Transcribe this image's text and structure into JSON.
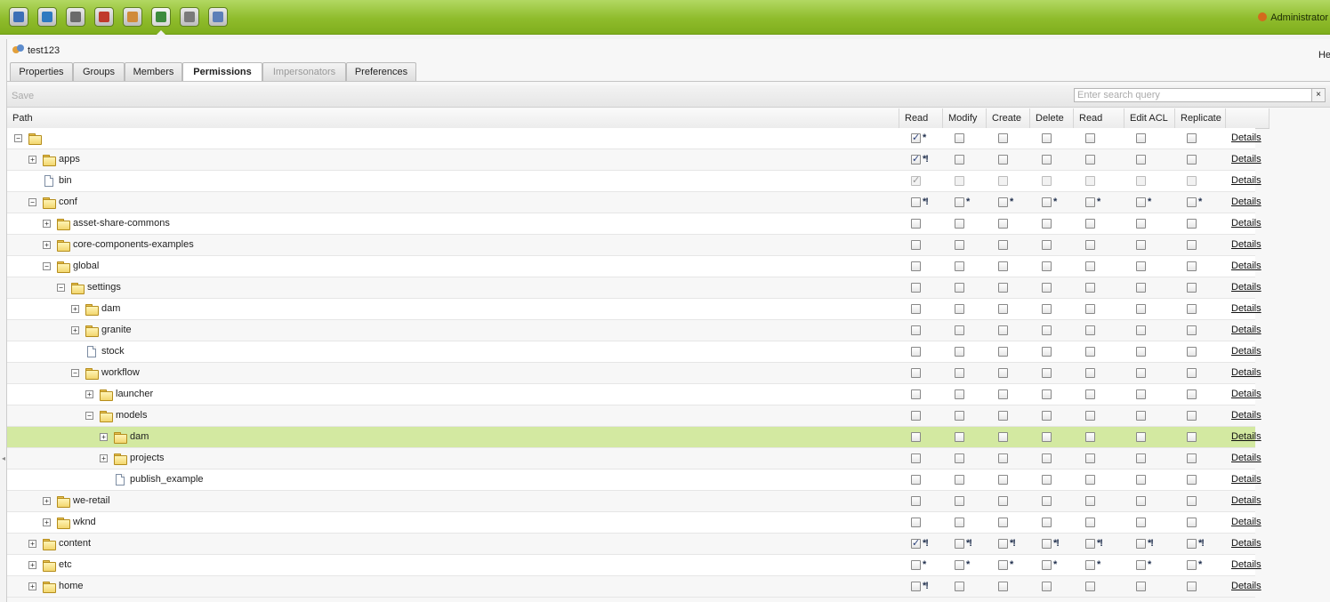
{
  "toolbar_icons": [
    {
      "name": "network-icon",
      "color": "#3d6fb6"
    },
    {
      "name": "globe-icon",
      "color": "#2f7ac0"
    },
    {
      "name": "binoculars-icon",
      "color": "#6a6a6a"
    },
    {
      "name": "megaphone-icon",
      "color": "#c0392b"
    },
    {
      "name": "envelope-icon",
      "color": "#d08b3a"
    },
    {
      "name": "users-icon",
      "color": "#3d8b3d"
    },
    {
      "name": "gear-icon",
      "color": "#7a7a7a"
    },
    {
      "name": "tag-icon",
      "color": "#5c7fb8"
    }
  ],
  "user_menu": {
    "label": "Administrator"
  },
  "panel": {
    "title": "test123",
    "help": "He",
    "tabs": [
      {
        "label": "Properties",
        "state": "normal"
      },
      {
        "label": "Groups",
        "state": "normal"
      },
      {
        "label": "Members",
        "state": "normal"
      },
      {
        "label": "Permissions",
        "state": "active"
      },
      {
        "label": "Impersonators",
        "state": "disabled"
      },
      {
        "label": "Preferences",
        "state": "normal"
      }
    ],
    "save_label": "Save",
    "search_placeholder": "Enter search query",
    "clear_label": "×"
  },
  "columns": [
    "Path",
    "Read",
    "Modify",
    "Create",
    "Delete",
    "Read ACL",
    "Edit ACL",
    "Replicate"
  ],
  "details_label": "Details",
  "rows": [
    {
      "label": "",
      "level": 0,
      "icon": "folder",
      "toggle": "minus",
      "perms": [
        [
          1,
          "*"
        ],
        [
          0,
          ""
        ],
        [
          0,
          ""
        ],
        [
          0,
          ""
        ],
        [
          0,
          ""
        ],
        [
          0,
          ""
        ],
        [
          0,
          ""
        ]
      ]
    },
    {
      "label": "apps",
      "level": 1,
      "icon": "folder",
      "toggle": "plus",
      "perms": [
        [
          1,
          "*!"
        ],
        [
          0,
          ""
        ],
        [
          0,
          ""
        ],
        [
          0,
          ""
        ],
        [
          0,
          ""
        ],
        [
          0,
          ""
        ],
        [
          0,
          ""
        ]
      ]
    },
    {
      "label": "bin",
      "level": 1,
      "icon": "doc",
      "toggle": "",
      "disabled": true,
      "perms": [
        [
          1,
          ""
        ],
        [
          0,
          ""
        ],
        [
          0,
          ""
        ],
        [
          0,
          ""
        ],
        [
          0,
          ""
        ],
        [
          0,
          ""
        ],
        [
          0,
          ""
        ]
      ]
    },
    {
      "label": "conf",
      "level": 1,
      "icon": "folder",
      "toggle": "minus",
      "perms": [
        [
          0,
          "*!"
        ],
        [
          0,
          "*"
        ],
        [
          0,
          "*"
        ],
        [
          0,
          "*"
        ],
        [
          0,
          "*"
        ],
        [
          0,
          "*"
        ],
        [
          0,
          "*"
        ]
      ]
    },
    {
      "label": "asset-share-commons",
      "level": 2,
      "icon": "folder",
      "toggle": "plus",
      "perms": [
        [
          0,
          ""
        ],
        [
          0,
          ""
        ],
        [
          0,
          ""
        ],
        [
          0,
          ""
        ],
        [
          0,
          ""
        ],
        [
          0,
          ""
        ],
        [
          0,
          ""
        ]
      ]
    },
    {
      "label": "core-components-examples",
      "level": 2,
      "icon": "folder",
      "toggle": "plus",
      "perms": [
        [
          0,
          ""
        ],
        [
          0,
          ""
        ],
        [
          0,
          ""
        ],
        [
          0,
          ""
        ],
        [
          0,
          ""
        ],
        [
          0,
          ""
        ],
        [
          0,
          ""
        ]
      ]
    },
    {
      "label": "global",
      "level": 2,
      "icon": "folder",
      "toggle": "minus",
      "perms": [
        [
          0,
          ""
        ],
        [
          0,
          ""
        ],
        [
          0,
          ""
        ],
        [
          0,
          ""
        ],
        [
          0,
          ""
        ],
        [
          0,
          ""
        ],
        [
          0,
          ""
        ]
      ]
    },
    {
      "label": "settings",
      "level": 3,
      "icon": "folder",
      "toggle": "minus",
      "perms": [
        [
          0,
          ""
        ],
        [
          0,
          ""
        ],
        [
          0,
          ""
        ],
        [
          0,
          ""
        ],
        [
          0,
          ""
        ],
        [
          0,
          ""
        ],
        [
          0,
          ""
        ]
      ]
    },
    {
      "label": "dam",
      "level": 4,
      "icon": "folder",
      "toggle": "plus",
      "perms": [
        [
          0,
          ""
        ],
        [
          0,
          ""
        ],
        [
          0,
          ""
        ],
        [
          0,
          ""
        ],
        [
          0,
          ""
        ],
        [
          0,
          ""
        ],
        [
          0,
          ""
        ]
      ]
    },
    {
      "label": "granite",
      "level": 4,
      "icon": "folder",
      "toggle": "plus",
      "perms": [
        [
          0,
          ""
        ],
        [
          0,
          ""
        ],
        [
          0,
          ""
        ],
        [
          0,
          ""
        ],
        [
          0,
          ""
        ],
        [
          0,
          ""
        ],
        [
          0,
          ""
        ]
      ]
    },
    {
      "label": "stock",
      "level": 4,
      "icon": "doc",
      "toggle": "",
      "perms": [
        [
          0,
          ""
        ],
        [
          0,
          ""
        ],
        [
          0,
          ""
        ],
        [
          0,
          ""
        ],
        [
          0,
          ""
        ],
        [
          0,
          ""
        ],
        [
          0,
          ""
        ]
      ]
    },
    {
      "label": "workflow",
      "level": 4,
      "icon": "folder",
      "toggle": "minus",
      "perms": [
        [
          0,
          ""
        ],
        [
          0,
          ""
        ],
        [
          0,
          ""
        ],
        [
          0,
          ""
        ],
        [
          0,
          ""
        ],
        [
          0,
          ""
        ],
        [
          0,
          ""
        ]
      ]
    },
    {
      "label": "launcher",
      "level": 5,
      "icon": "folder",
      "toggle": "plus",
      "perms": [
        [
          0,
          ""
        ],
        [
          0,
          ""
        ],
        [
          0,
          ""
        ],
        [
          0,
          ""
        ],
        [
          0,
          ""
        ],
        [
          0,
          ""
        ],
        [
          0,
          ""
        ]
      ]
    },
    {
      "label": "models",
      "level": 5,
      "icon": "folder",
      "toggle": "minus",
      "perms": [
        [
          0,
          ""
        ],
        [
          0,
          ""
        ],
        [
          0,
          ""
        ],
        [
          0,
          ""
        ],
        [
          0,
          ""
        ],
        [
          0,
          ""
        ],
        [
          0,
          ""
        ]
      ]
    },
    {
      "label": "dam",
      "level": 6,
      "icon": "folder",
      "toggle": "plus",
      "selected": true,
      "perms": [
        [
          0,
          ""
        ],
        [
          0,
          ""
        ],
        [
          0,
          ""
        ],
        [
          0,
          ""
        ],
        [
          0,
          ""
        ],
        [
          0,
          ""
        ],
        [
          0,
          ""
        ]
      ]
    },
    {
      "label": "projects",
      "level": 6,
      "icon": "folder",
      "toggle": "plus",
      "perms": [
        [
          0,
          ""
        ],
        [
          0,
          ""
        ],
        [
          0,
          ""
        ],
        [
          0,
          ""
        ],
        [
          0,
          ""
        ],
        [
          0,
          ""
        ],
        [
          0,
          ""
        ]
      ]
    },
    {
      "label": "publish_example",
      "level": 6,
      "icon": "doc",
      "toggle": "",
      "perms": [
        [
          0,
          ""
        ],
        [
          0,
          ""
        ],
        [
          0,
          ""
        ],
        [
          0,
          ""
        ],
        [
          0,
          ""
        ],
        [
          0,
          ""
        ],
        [
          0,
          ""
        ]
      ]
    },
    {
      "label": "we-retail",
      "level": 2,
      "icon": "folder",
      "toggle": "plus",
      "perms": [
        [
          0,
          ""
        ],
        [
          0,
          ""
        ],
        [
          0,
          ""
        ],
        [
          0,
          ""
        ],
        [
          0,
          ""
        ],
        [
          0,
          ""
        ],
        [
          0,
          ""
        ]
      ]
    },
    {
      "label": "wknd",
      "level": 2,
      "icon": "folder",
      "toggle": "plus",
      "perms": [
        [
          0,
          ""
        ],
        [
          0,
          ""
        ],
        [
          0,
          ""
        ],
        [
          0,
          ""
        ],
        [
          0,
          ""
        ],
        [
          0,
          ""
        ],
        [
          0,
          ""
        ]
      ]
    },
    {
      "label": "content",
      "level": 1,
      "icon": "folder",
      "toggle": "plus",
      "perms": [
        [
          1,
          "*!"
        ],
        [
          0,
          "*!"
        ],
        [
          0,
          "*!"
        ],
        [
          0,
          "*!"
        ],
        [
          0,
          "*!"
        ],
        [
          0,
          "*!"
        ],
        [
          0,
          "*!"
        ]
      ]
    },
    {
      "label": "etc",
      "level": 1,
      "icon": "folder",
      "toggle": "plus",
      "perms": [
        [
          0,
          "*"
        ],
        [
          0,
          "*"
        ],
        [
          0,
          "*"
        ],
        [
          0,
          "*"
        ],
        [
          0,
          "*"
        ],
        [
          0,
          "*"
        ],
        [
          0,
          "*"
        ]
      ]
    },
    {
      "label": "home",
      "level": 1,
      "icon": "folder",
      "toggle": "plus",
      "perms": [
        [
          0,
          "*!"
        ],
        [
          0,
          ""
        ],
        [
          0,
          ""
        ],
        [
          0,
          ""
        ],
        [
          0,
          ""
        ],
        [
          0,
          ""
        ],
        [
          0,
          ""
        ]
      ]
    }
  ],
  "colors": {
    "topbar": "#8fbc2c",
    "selected_row": "#d3e9a1"
  }
}
